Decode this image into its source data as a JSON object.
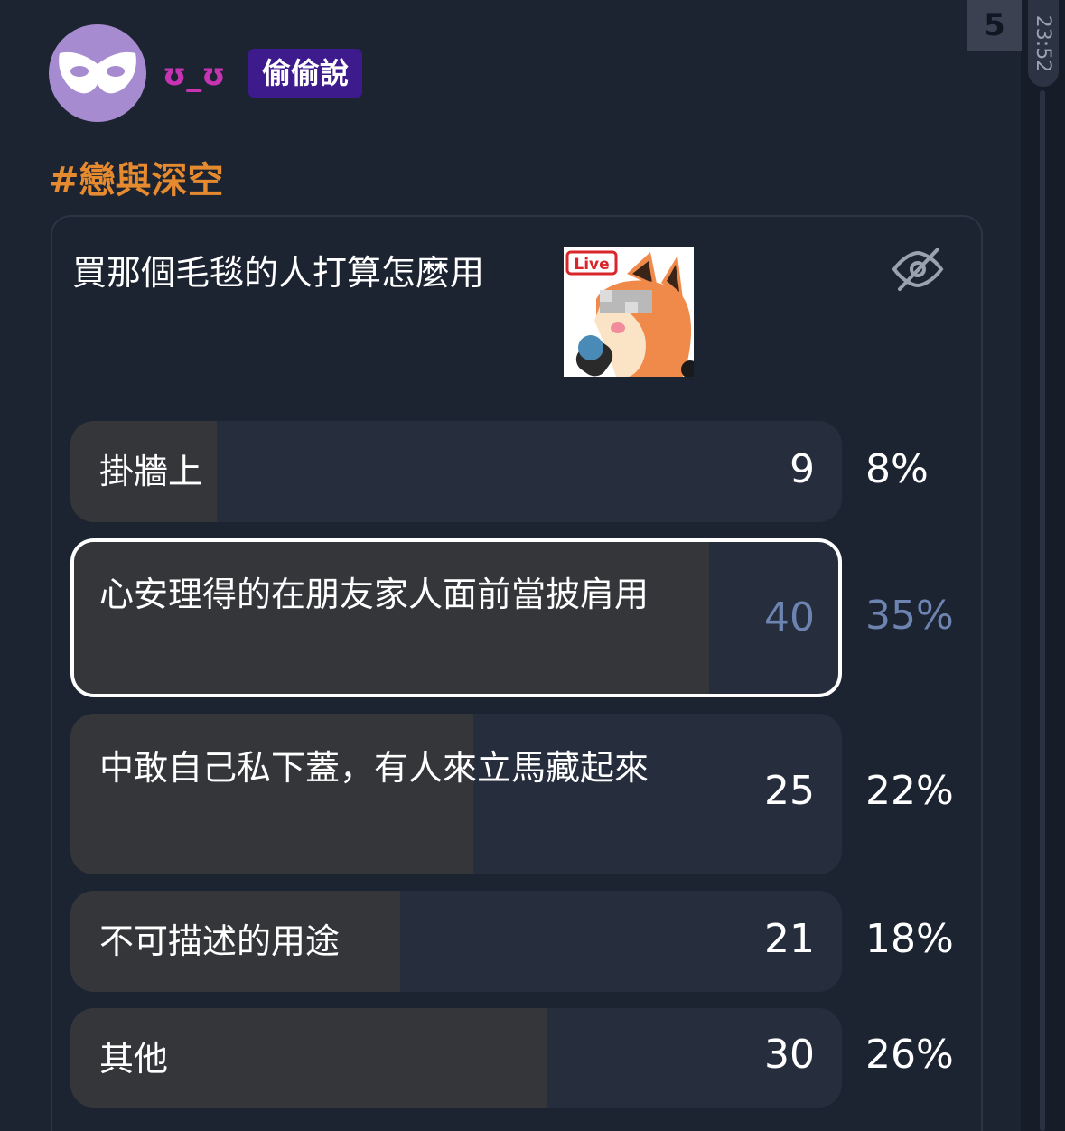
{
  "edge": {
    "count_badge": "5",
    "time": "23:52"
  },
  "post": {
    "username": "ʊ_ʊ",
    "anon_badge": "偷偷說",
    "hashtag": "#戀與深空"
  },
  "poll": {
    "question": "買那個毛毯的人打算怎麼用",
    "sticker_label": "Live",
    "options": [
      {
        "label": "掛牆上",
        "count": "9",
        "percent": "8%",
        "share": 0.08,
        "selected": false
      },
      {
        "label": "心安理得的在朋友家人面前當披肩用",
        "count": "40",
        "percent": "35%",
        "share": 0.35,
        "selected": true
      },
      {
        "label": "中敢自己私下蓋，有人來立馬藏起來",
        "count": "25",
        "percent": "22%",
        "share": 0.22,
        "selected": false
      },
      {
        "label": "不可描述的用途",
        "count": "21",
        "percent": "18%",
        "share": 0.18,
        "selected": false
      },
      {
        "label": "其他",
        "count": "30",
        "percent": "26%",
        "share": 0.26,
        "selected": false
      }
    ]
  },
  "colors": {
    "background": "#1c2331",
    "username": "#c634b4",
    "anon_badge": "#3d1b8c",
    "hashtag": "#e58a2e",
    "selected_text": "#6d84b1",
    "fill": "#353639"
  }
}
